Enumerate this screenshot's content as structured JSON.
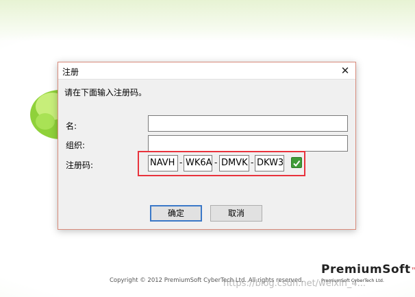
{
  "dialog": {
    "title": "注册",
    "close_glyph": "✕",
    "instruction": "请在下面输入注册码。",
    "name_label": "名:",
    "org_label": "组织:",
    "code_label": "注册码:",
    "name_value": "",
    "org_value": "",
    "code_segments": [
      "NAVH",
      "WK6A",
      "DMVK",
      "DKW3"
    ],
    "code_separator": "-",
    "ok_label": "确定",
    "cancel_label": "取消"
  },
  "splash": {
    "copyright": "Copyright © 2012 PremiumSoft CyberTech Ltd. All rights reserved.",
    "brand_main": "PremiumSoft",
    "brand_tm": "™",
    "brand_sub": "PremiumSoft CyberTech Ltd.",
    "watermark": "https://blog.csdn.net/weixin_4..."
  },
  "colors": {
    "highlight": "#e8323c",
    "check": "#3f9b38",
    "default_button_border": "#3a78c8"
  }
}
